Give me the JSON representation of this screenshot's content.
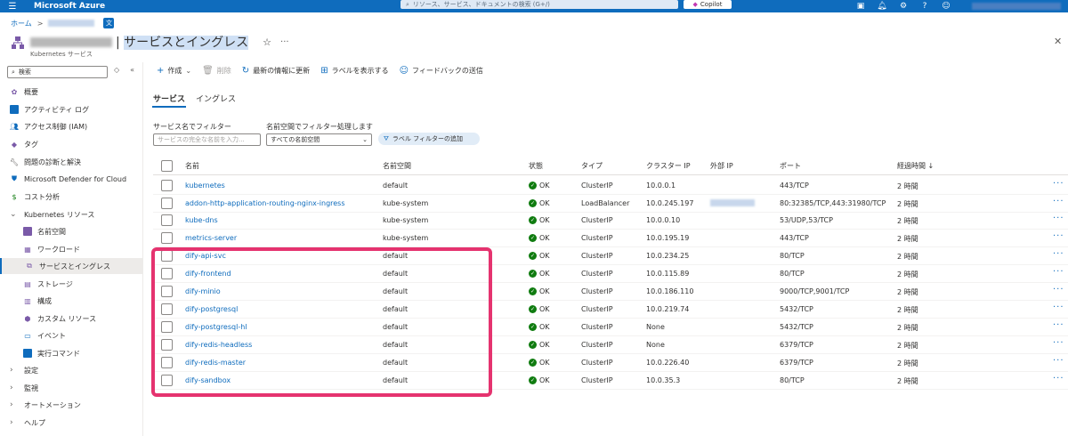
{
  "topbar": {
    "brand": "Microsoft Azure",
    "search_placeholder": "リソース、サービス、ドキュメントの検索 (G+/)",
    "copilot_label": "Copilot",
    "icons": [
      "cloud-shell-icon",
      "bell-icon",
      "gear-icon",
      "help-icon",
      "feedback-icon"
    ]
  },
  "breadcrumb": {
    "home": "ホーム",
    "separator": ">"
  },
  "title": {
    "main": "サービスとイングレス",
    "separator": "|",
    "subtitle": "Kubernetes サービス"
  },
  "sidebar": {
    "search_placeholder": "検索",
    "items": [
      {
        "label": "概要",
        "icon": "overview-icon"
      },
      {
        "label": "アクティビティ ログ",
        "icon": "activity-log-icon"
      },
      {
        "label": "アクセス制御 (IAM)",
        "icon": "iam-icon"
      },
      {
        "label": "タグ",
        "icon": "tag-icon"
      },
      {
        "label": "問題の診断と解決",
        "icon": "wrench-icon"
      },
      {
        "label": "Microsoft Defender for Cloud",
        "icon": "shield-icon"
      },
      {
        "label": "コスト分析",
        "icon": "cost-icon"
      },
      {
        "label": "Kubernetes リソース",
        "icon": "chevron-down-icon"
      },
      {
        "label": "名前空間",
        "icon": "namespace-icon"
      },
      {
        "label": "ワークロード",
        "icon": "workload-icon"
      },
      {
        "label": "サービスとイングレス",
        "icon": "services-icon"
      },
      {
        "label": "ストレージ",
        "icon": "storage-icon"
      },
      {
        "label": "構成",
        "icon": "config-icon"
      },
      {
        "label": "カスタム リソース",
        "icon": "custom-resource-icon"
      },
      {
        "label": "イベント",
        "icon": "event-icon"
      },
      {
        "label": "実行コマンド",
        "icon": "run-command-icon"
      },
      {
        "label": "設定",
        "icon": "chevron-right-icon"
      },
      {
        "label": "監視",
        "icon": "chevron-right-icon"
      },
      {
        "label": "オートメーション",
        "icon": "chevron-right-icon"
      },
      {
        "label": "ヘルプ",
        "icon": "chevron-right-icon"
      }
    ]
  },
  "toolbar": {
    "create": "作成",
    "delete": "削除",
    "refresh": "最新の情報に更新",
    "show_labels": "ラベルを表示する",
    "feedback": "フィードバックの送信"
  },
  "tabs": [
    "サービス",
    "イングレス"
  ],
  "filters": {
    "name_label": "サービス名でフィルター",
    "name_placeholder": "サービスの完全な名前を入力...",
    "namespace_label": "名前空間でフィルター処理します",
    "namespace_value": "すべての名前空間",
    "add_label_filter": "ラベル フィルターの追加"
  },
  "table": {
    "headers": [
      "名前",
      "名前空間",
      "状態",
      "タイプ",
      "クラスター IP",
      "外部 IP",
      "ポート",
      "経過時間 ↓"
    ],
    "rows": [
      {
        "name": "kubernetes",
        "namespace": "default",
        "status": "OK",
        "type": "ClusterIP",
        "cluster_ip": "10.0.0.1",
        "external_ip": "",
        "ports": "443/TCP",
        "age": "2 時間"
      },
      {
        "name": "addon-http-application-routing-nginx-ingress",
        "namespace": "kube-system",
        "status": "OK",
        "type": "LoadBalancer",
        "cluster_ip": "10.0.245.197",
        "external_ip": "",
        "ports": "80:32385/TCP,443:31980/TCP",
        "age": "2 時間"
      },
      {
        "name": "kube-dns",
        "namespace": "kube-system",
        "status": "OK",
        "type": "ClusterIP",
        "cluster_ip": "10.0.0.10",
        "external_ip": "",
        "ports": "53/UDP,53/TCP",
        "age": "2 時間"
      },
      {
        "name": "metrics-server",
        "namespace": "kube-system",
        "status": "OK",
        "type": "ClusterIP",
        "cluster_ip": "10.0.195.19",
        "external_ip": "",
        "ports": "443/TCP",
        "age": "2 時間"
      },
      {
        "name": "dify-api-svc",
        "namespace": "default",
        "status": "OK",
        "type": "ClusterIP",
        "cluster_ip": "10.0.234.25",
        "external_ip": "",
        "ports": "80/TCP",
        "age": "2 時間"
      },
      {
        "name": "dify-frontend",
        "namespace": "default",
        "status": "OK",
        "type": "ClusterIP",
        "cluster_ip": "10.0.115.89",
        "external_ip": "",
        "ports": "80/TCP",
        "age": "2 時間"
      },
      {
        "name": "dify-minio",
        "namespace": "default",
        "status": "OK",
        "type": "ClusterIP",
        "cluster_ip": "10.0.186.110",
        "external_ip": "",
        "ports": "9000/TCP,9001/TCP",
        "age": "2 時間"
      },
      {
        "name": "dify-postgresql",
        "namespace": "default",
        "status": "OK",
        "type": "ClusterIP",
        "cluster_ip": "10.0.219.74",
        "external_ip": "",
        "ports": "5432/TCP",
        "age": "2 時間"
      },
      {
        "name": "dify-postgresql-hl",
        "namespace": "default",
        "status": "OK",
        "type": "ClusterIP",
        "cluster_ip": "None",
        "external_ip": "",
        "ports": "5432/TCP",
        "age": "2 時間"
      },
      {
        "name": "dify-redis-headless",
        "namespace": "default",
        "status": "OK",
        "type": "ClusterIP",
        "cluster_ip": "None",
        "external_ip": "",
        "ports": "6379/TCP",
        "age": "2 時間"
      },
      {
        "name": "dify-redis-master",
        "namespace": "default",
        "status": "OK",
        "type": "ClusterIP",
        "cluster_ip": "10.0.226.40",
        "external_ip": "",
        "ports": "6379/TCP",
        "age": "2 時間"
      },
      {
        "name": "dify-sandbox",
        "namespace": "default",
        "status": "OK",
        "type": "ClusterIP",
        "cluster_ip": "10.0.35.3",
        "external_ip": "",
        "ports": "80/TCP",
        "age": "2 時間"
      }
    ]
  },
  "colors": {
    "accent": "#0f6cbd",
    "ok": "#107c10",
    "highlight": "#e5336f"
  }
}
